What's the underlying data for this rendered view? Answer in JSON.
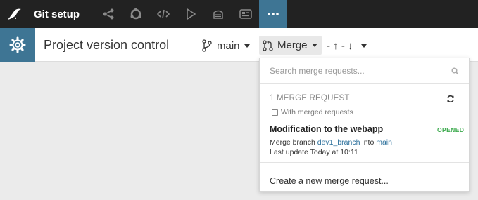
{
  "app": {
    "title": "Git setup",
    "accent": "#3e7594",
    "topbar_bg": "#222222"
  },
  "topbar": {
    "icons": [
      "flow-icon",
      "cycle-icon",
      "code-icon",
      "play-icon",
      "stack-icon",
      "dashboard-icon",
      "more-icon"
    ],
    "active": "more-icon"
  },
  "header": {
    "page_title": "Project version control",
    "branch_label": "main",
    "merge_label": "Merge",
    "sync_label": "- ↑ - ↓"
  },
  "dropdown": {
    "search_placeholder": "Search merge requests...",
    "count_label": "1 MERGE REQUEST",
    "with_merged_label": "With merged requests",
    "with_merged_checked": false,
    "merge_request": {
      "title": "Modification to the webapp",
      "status": "OPENED",
      "status_color": "#3daa4e",
      "desc_prefix": "Merge branch",
      "source_branch": "dev1_branch",
      "desc_middle": "into",
      "target_branch": "main",
      "last_update": "Last update Today at 10:11"
    },
    "create_label": "Create a new merge request..."
  }
}
